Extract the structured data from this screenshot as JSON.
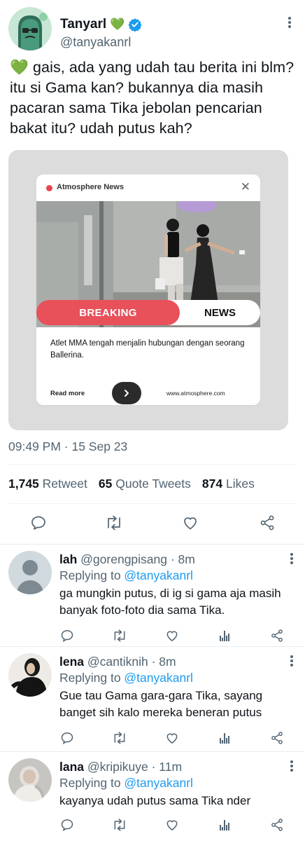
{
  "tweet": {
    "author_name": "Tanyarl",
    "author_emoji": "💚",
    "author_handle": "@tanyakanrl",
    "text_emoji": "💚",
    "text": " gais, ada yang udah tau berita ini blm? itu si Gama kan? bukannya dia masih pacaran sama Tika jebolan pencarian bakat itu? udah putus kah?",
    "timestamp": "09:49 PM · 15 Sep 23",
    "stats": {
      "retweets_count": "1,745",
      "retweets_label": "Retweet",
      "quotes_count": "65",
      "quotes_label": "Quote Tweets",
      "likes_count": "874",
      "likes_label": "Likes"
    }
  },
  "news_card": {
    "source": "Atmosphere News",
    "breaking_label": "BREAKING",
    "news_label": "NEWS",
    "headline": "Atlet MMA tengah menjalin hubungan dengan seorang Ballerina.",
    "read_more": "Read more",
    "url": "www.atmosphere.com"
  },
  "replies": [
    {
      "name": "lah",
      "handle": "@gorengpisang",
      "time": " · 8m",
      "replying_label": "Replying to ",
      "replying_to": "@tanyakanrl",
      "text": "ga mungkin putus, di ig si gama aja masih banyak foto-foto dia sama Tika."
    },
    {
      "name": "lena",
      "handle": "@cantiknih",
      "time": " · 8m",
      "replying_label": "Replying to ",
      "replying_to": "@tanyakanrl",
      "text": "Gue tau Gama gara-gara Tika, sayang banget sih kalo mereka beneran putus"
    },
    {
      "name": "lana",
      "handle": "@kripikuye",
      "time": " · 11m",
      "replying_label": "Replying to ",
      "replying_to": "@tanyakanrl",
      "text": "kayanya udah putus sama Tika nder"
    }
  ],
  "colors": {
    "accent": "#1d9bf0",
    "breaking": "#e8505a",
    "muted": "#536471"
  },
  "icons": [
    "verified-badge-icon",
    "more-icon",
    "reply-icon",
    "retweet-icon",
    "like-icon",
    "share-icon",
    "views-icon",
    "close-icon",
    "arrow-right-icon"
  ]
}
